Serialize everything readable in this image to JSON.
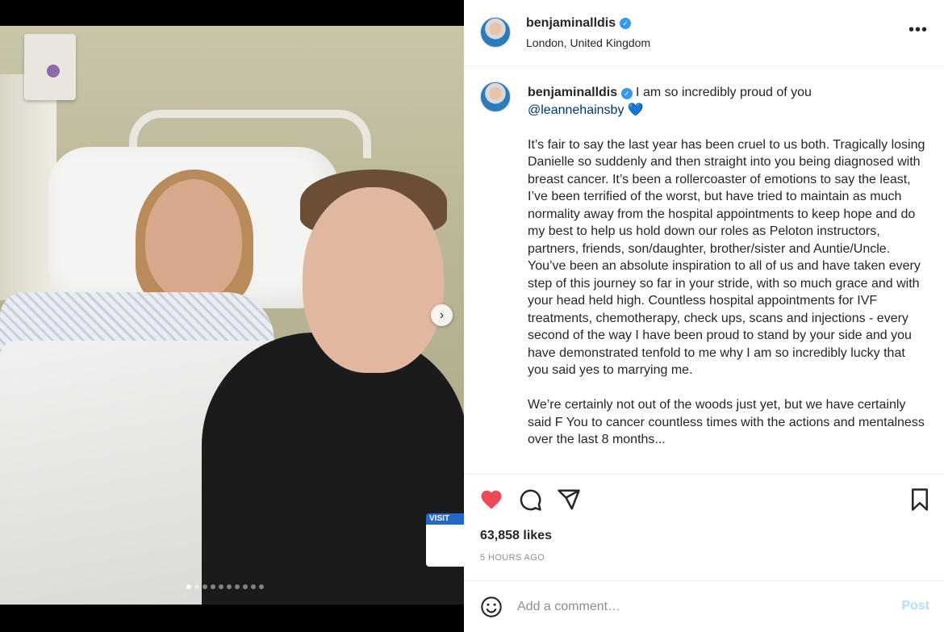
{
  "post": {
    "username": "benjaminalldis",
    "location": "London, United Kingdom",
    "verified": true,
    "more_icon": "more-horizontal-icon"
  },
  "media": {
    "description_icon": "photo",
    "carousel_count": 10,
    "carousel_active_index": 0,
    "visitor_badge": "VISIT"
  },
  "caption": {
    "username": "benjaminalldis",
    "first_line": "I am so incredibly proud of you",
    "mention": "@leannehainsby",
    "heart": "💙",
    "paragraphs": [
      "It’s fair to say the last year has been cruel to us both. Tragically losing Danielle so suddenly and then straight into you being diagnosed with breast cancer. It’s been a rollercoaster of emotions to say the least, I’ve been terrified of the worst, but have tried to maintain as much normality away from the hospital appointments to keep hope and do my best to help us hold down our roles as Peloton instructors, partners, friends, son/daughter, brother/sister and Auntie/Uncle. You’ve been an absolute inspiration to all of us and have taken every step of this journey so far in your stride, with so much grace and with your head held high. Countless hospital appointments for IVF treatments, chemotherapy, check ups, scans and injections - every second of the way I have been proud to stand by your side and you have demonstrated tenfold to me why I am so incredibly lucky that you said yes to marrying me.",
      "We’re certainly not out of the woods just yet, but we have certainly said F You to cancer countless times with the actions and mentalness over the last 8 months..."
    ]
  },
  "actions": {
    "like_icon": "heart-filled-icon",
    "comment_icon": "comment-icon",
    "share_icon": "send-icon",
    "save_icon": "bookmark-icon",
    "like_color": "#ed4956"
  },
  "likes_text": "63,858 likes",
  "timestamp": "5 HOURS AGO",
  "comment": {
    "placeholder": "Add a comment…",
    "post_label": "Post",
    "emoji_icon": "emoji-icon"
  }
}
